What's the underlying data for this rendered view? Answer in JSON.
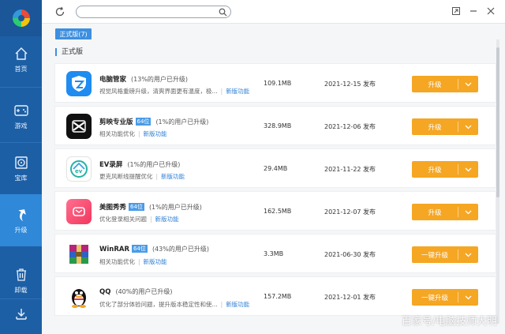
{
  "sidebar": {
    "items": [
      {
        "label": "首页",
        "icon": "home-icon"
      },
      {
        "label": "游戏",
        "icon": "gamepad-icon"
      },
      {
        "label": "宝库",
        "icon": "disc-icon"
      },
      {
        "label": "升级",
        "icon": "upgrade-arrow-icon"
      },
      {
        "label": "卸载",
        "icon": "trash-icon"
      },
      {
        "label": "",
        "icon": "download-icon"
      }
    ],
    "active_index": 3
  },
  "search": {
    "value": "",
    "placeholder": ""
  },
  "tab": {
    "label": "正式版(7)"
  },
  "section": {
    "title": "正式版"
  },
  "apps": [
    {
      "name": "电脑管家",
      "badge": "",
      "users": "(13%的用户已升级)",
      "desc": "视觉风格重磅升级，清爽界面更有温度，极...",
      "feature": "新版功能",
      "size": "109.1MB",
      "date": "2021-12-15 发布",
      "button": "升级",
      "icon": "tencent-pc-manager-icon"
    },
    {
      "name": "剪映专业版",
      "badge": "64位",
      "users": "(1%的用户已升级)",
      "desc": "相关功能优化",
      "feature": "新版功能",
      "size": "328.9MB",
      "date": "2021-12-06 发布",
      "button": "升级",
      "icon": "capcut-icon"
    },
    {
      "name": "EV录屏",
      "badge": "",
      "users": "(1%的用户已升级)",
      "desc": "更克风断线提醒优化",
      "feature": "新版功能",
      "size": "29.4MB",
      "date": "2021-11-22 发布",
      "button": "升级",
      "icon": "ev-recorder-icon"
    },
    {
      "name": "美图秀秀",
      "badge": "64位",
      "users": "(1%的用户已升级)",
      "desc": "优化登录相关问题",
      "feature": "新版功能",
      "size": "162.5MB",
      "date": "2021-12-07 发布",
      "button": "升级",
      "icon": "meitu-icon"
    },
    {
      "name": "WinRAR",
      "badge": "64位",
      "users": "(43%的用户已升级)",
      "desc": "相关功能优化",
      "feature": "新版功能",
      "size": "3.3MB",
      "date": "2021-06-30 发布",
      "button": "一键升级",
      "icon": "winrar-icon"
    },
    {
      "name": "QQ",
      "badge": "",
      "users": "(40%的用户已升级)",
      "desc": "优化了部分体验问题，提升版本稳定性和使...",
      "feature": "新版功能",
      "size": "157.2MB",
      "date": "2021-12-01 发布",
      "button": "一键升级",
      "icon": "qq-penguin-icon"
    }
  ],
  "watermark": "百家号/电脑技师大明",
  "colors": {
    "sidebar": "#1d5fa5",
    "active": "#2f88d8",
    "accent": "#3d8fdf",
    "button": "#f5a623"
  }
}
